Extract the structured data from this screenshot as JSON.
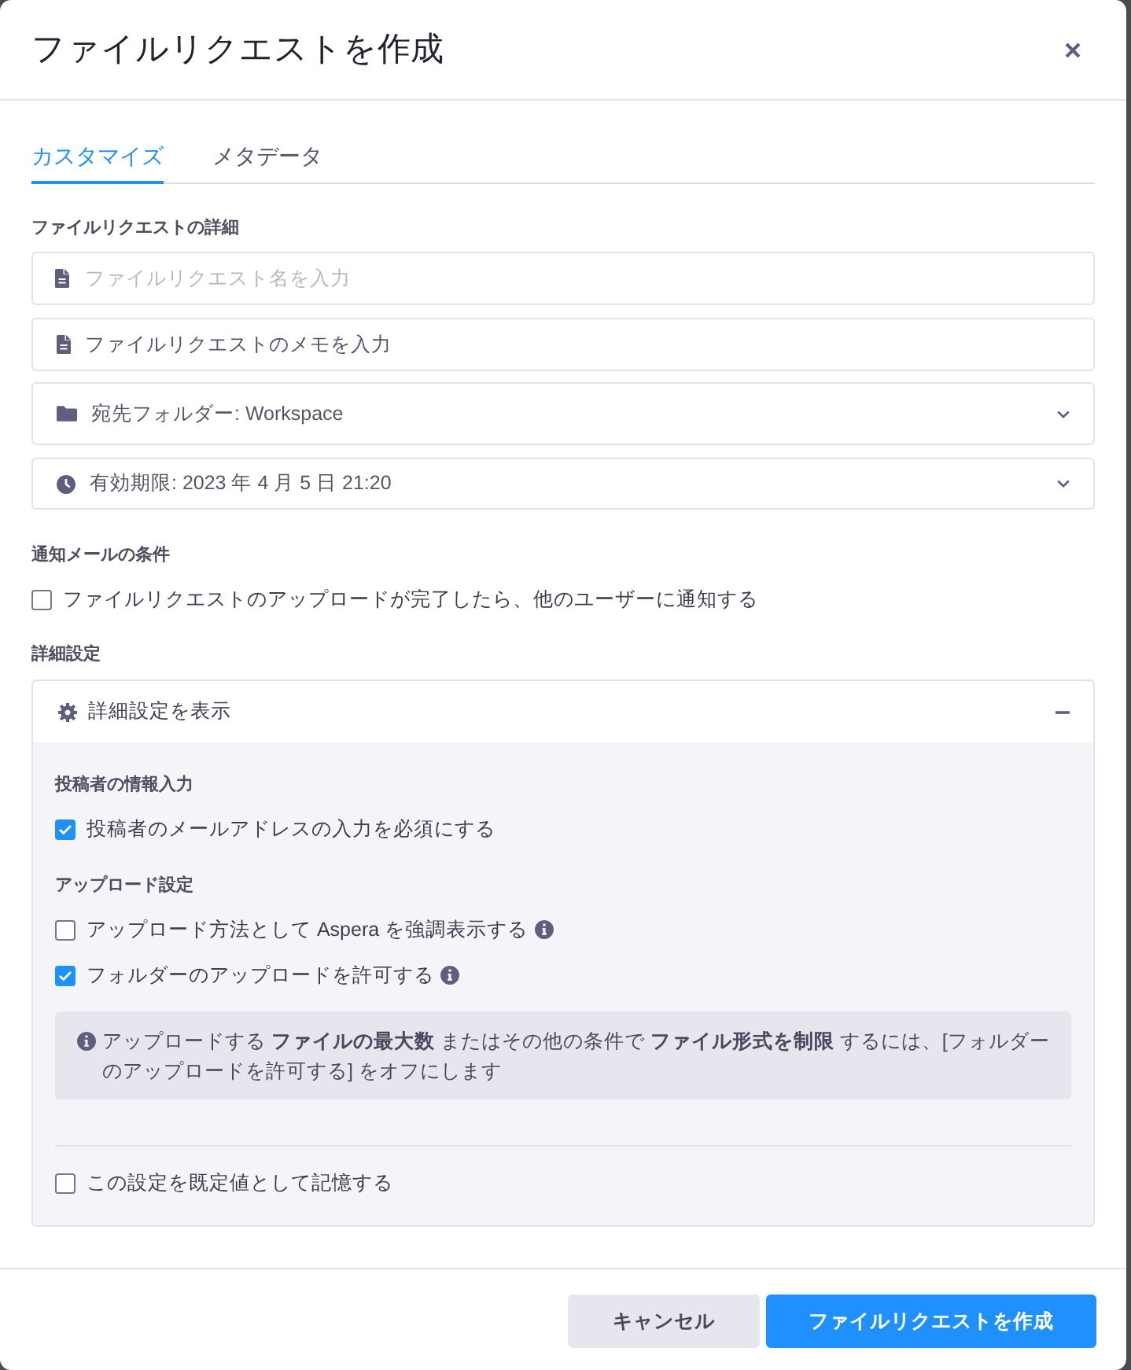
{
  "dialog": {
    "title": "ファイルリクエストを作成"
  },
  "tabs": [
    {
      "label": "カスタマイズ",
      "selected": true
    },
    {
      "label": "メタデータ",
      "selected": false
    }
  ],
  "details": {
    "heading": "ファイルリクエストの詳細",
    "fields": [
      {
        "kind": "name",
        "placeholder": "ファイルリクエスト名を入力"
      },
      {
        "kind": "memo",
        "label": "ファイルリクエストのメモを入力"
      },
      {
        "kind": "folder",
        "value": "宛先フォルダー: Workspace"
      },
      {
        "kind": "expiry",
        "value": "有効期限: 2023 年 4 月 5 日 21:20"
      }
    ]
  },
  "notification": {
    "heading": "通知メールの条件",
    "options": [
      {
        "label": "ファイルリクエストのアップロードが完了したら、他のユーザーに通知する",
        "checked": false,
        "info": false
      }
    ]
  },
  "advanced": {
    "heading": "詳細設定",
    "toggle": {
      "label": "詳細設定を表示",
      "expanded": true
    },
    "groups": [
      {
        "heading": "投稿者の情報入力",
        "options": [
          {
            "label": "投稿者のメールアドレスの入力を必須にする",
            "checked": true,
            "info": false
          }
        ]
      },
      {
        "heading": "アップロード設定",
        "options": [
          {
            "label": "アップロード方法として Aspera を強調表示する",
            "checked": false,
            "info": true
          },
          {
            "label": "フォルダーのアップロードを許可する",
            "checked": true,
            "info": true
          }
        ],
        "note": "アップロードする **ファイルの最大数** またはその他の条件で **ファイル形式を制限** するには、[フォルダーのアップロードを許可する] をオフにします"
      }
    ],
    "remember": {
      "label": "この設定を既定値として記憶する",
      "checked": false
    }
  },
  "buttons": [
    {
      "kind": "secondary",
      "label": "キャンセル"
    },
    {
      "kind": "primary",
      "label": "ファイルリクエストを作成"
    }
  ]
}
